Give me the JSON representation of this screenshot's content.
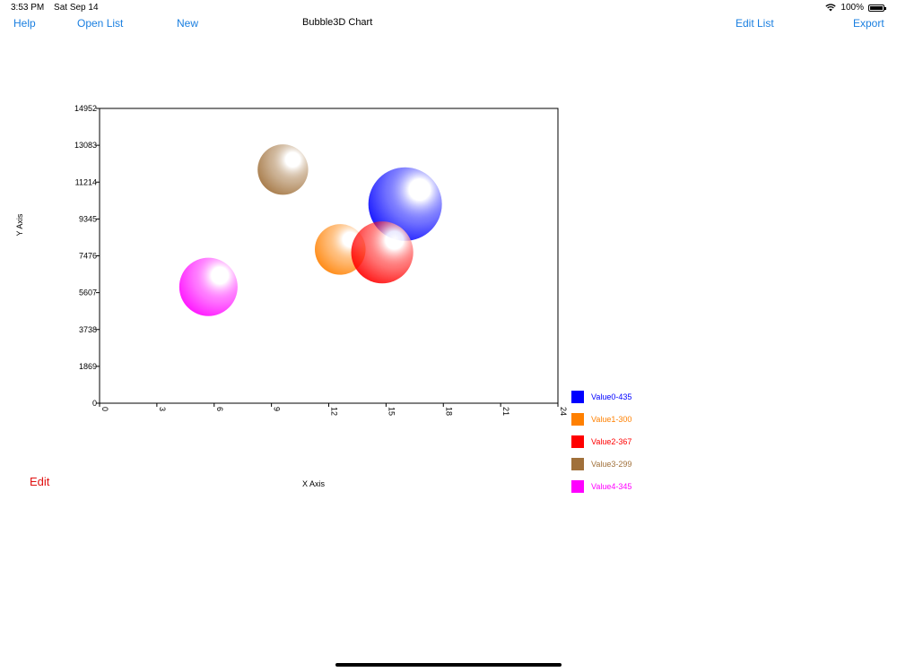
{
  "status_bar": {
    "time": "3:53 PM",
    "date": "Sat Sep 14",
    "battery": "100%"
  },
  "nav": {
    "help": "Help",
    "open_list": "Open List",
    "new": "New",
    "title": "Bubble3D Chart",
    "edit_list": "Edit List",
    "export": "Export"
  },
  "edit_label": "Edit",
  "chart_data": {
    "type": "scatter",
    "title": "",
    "xlabel": "X Axis",
    "ylabel": "Y Axis",
    "xlim": [
      0,
      24
    ],
    "ylim": [
      0,
      14952
    ],
    "x_ticks": [
      "0",
      "3",
      "6",
      "9",
      "12",
      "15",
      "18",
      "21",
      "24"
    ],
    "y_ticks": [
      "0",
      "1869",
      "3738",
      "5607",
      "7476",
      "9345",
      "11214",
      "13083",
      "14952"
    ],
    "grid": false,
    "legend_position": "right",
    "series": [
      {
        "name": "Value0-435",
        "x": 16.0,
        "y": 10100,
        "size": 435,
        "color": "#0000ff"
      },
      {
        "name": "Value1-300",
        "x": 12.6,
        "y": 7800,
        "size": 300,
        "color": "#ff8000"
      },
      {
        "name": "Value2-367",
        "x": 14.8,
        "y": 7650,
        "size": 367,
        "color": "#ff0000"
      },
      {
        "name": "Value3-299",
        "x": 9.6,
        "y": 11850,
        "size": 299,
        "color": "#a0703a"
      },
      {
        "name": "Value4-345",
        "x": 5.7,
        "y": 5900,
        "size": 345,
        "color": "#ff00ff"
      }
    ]
  }
}
